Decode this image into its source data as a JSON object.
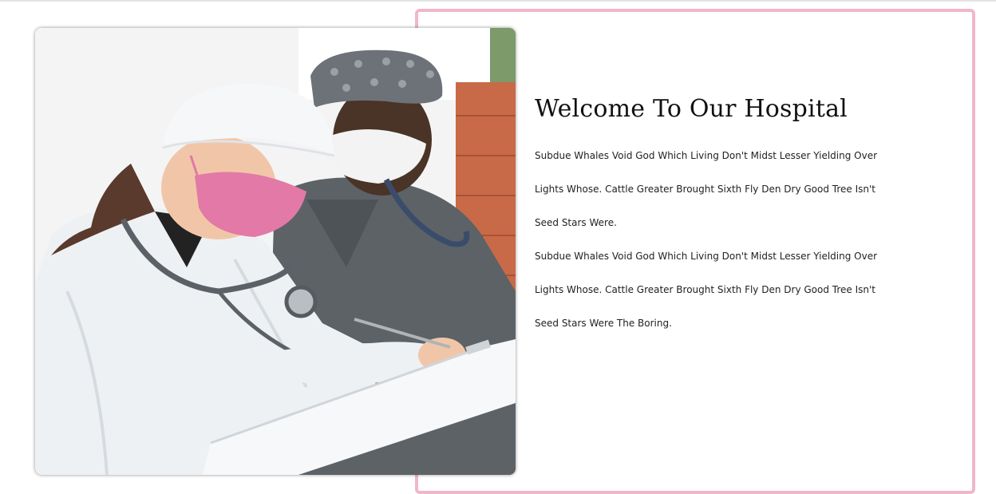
{
  "welcome": {
    "title": "Welcome To Our Hospital",
    "paragraphs": [
      "Subdue Whales Void God Which Living Don't Midst Lesser Yielding Over Lights Whose. Cattle Greater Brought Sixth Fly Den Dry Good Tree Isn't Seed Stars Were.",
      "Subdue Whales Void God Which Living Don't Midst Lesser Yielding Over Lights Whose. Cattle Greater Brought Sixth Fly Den Dry Good Tree Isn't Seed Stars Were The Boring."
    ]
  },
  "colors": {
    "frame_border": "#f2b6cb",
    "mask_pink": "#e279a6",
    "scrubs_grey": "#5c6266",
    "coat_white": "#eef1f4"
  },
  "image": {
    "icon": "doctors-photo"
  }
}
